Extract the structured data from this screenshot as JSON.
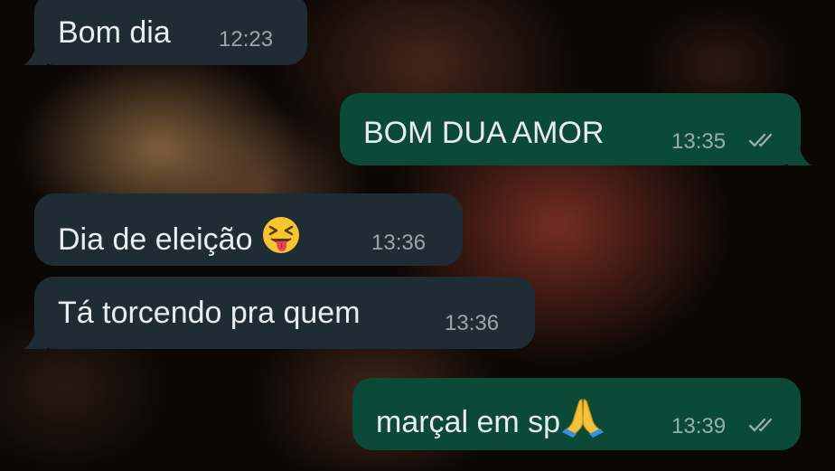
{
  "chat": {
    "messages": [
      {
        "direction": "incoming",
        "text": "Bom dia",
        "time": "12:23"
      },
      {
        "direction": "outgoing",
        "text": "BOM DUA AMOR",
        "time": "13:35",
        "status": "read"
      },
      {
        "direction": "incoming",
        "text": "Dia de eleição",
        "emoji": "squinting-face-with-tongue",
        "time": "13:36"
      },
      {
        "direction": "incoming",
        "text": "Tá torcendo pra quem",
        "time": "13:36"
      },
      {
        "direction": "outgoing",
        "text": "marçal em sp",
        "emoji": "folded-hands",
        "time": "13:39",
        "status": "read"
      }
    ]
  },
  "colors": {
    "incoming_bubble": "#202c33",
    "outgoing_bubble": "#0b4a36",
    "text": "#e9edef",
    "wallpaper": "#0b0705"
  }
}
